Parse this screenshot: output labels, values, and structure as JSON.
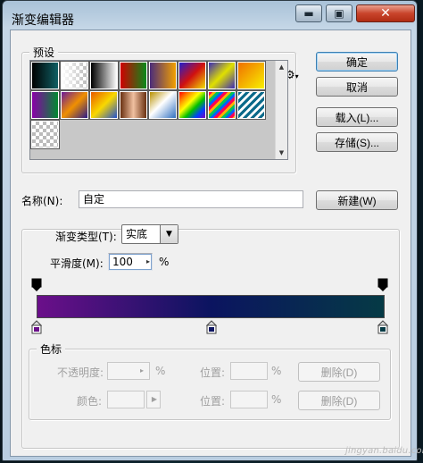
{
  "window": {
    "title": "渐变编辑器",
    "controls": {
      "minimize": "▬",
      "maximize": "▣",
      "close": "✕"
    }
  },
  "presets": {
    "legend": "预设",
    "menu_icon": "gear-icon",
    "swatches": [
      {
        "bg": "linear-gradient(90deg,#000,#0f5f64)"
      },
      {
        "bg": "linear-gradient(90deg,#fff 0%,rgba(255,255,255,0) 100%),repeating-conic-gradient(#bbb 0 25%,#fff 0 50%) 0 0/8px 8px"
      },
      {
        "bg": "linear-gradient(90deg,#000,#fff)"
      },
      {
        "bg": "linear-gradient(90deg,#d00000,#0a8a1a)"
      },
      {
        "bg": "linear-gradient(90deg,#4b2c7a,#f2a000)"
      },
      {
        "bg": "linear-gradient(135deg,#2020d0 0%,#d01010 50%,#f0e000 100%)"
      },
      {
        "bg": "linear-gradient(135deg,#3a2ab8 0%,#e0e000 50%,#3a2ab8 100%)"
      },
      {
        "bg": "linear-gradient(135deg,#f07000,#f8f000)"
      },
      {
        "bg": "linear-gradient(90deg,#8a00a8,#008a30)"
      },
      {
        "bg": "linear-gradient(135deg,#6a1a9a 0%,#f09000 50%,#2a1a8a 100%)"
      },
      {
        "bg": "linear-gradient(135deg,#e85a00 0%,#f8d800 50%,#2050d0 100%)"
      },
      {
        "bg": "linear-gradient(90deg,#6a3010,#f0c0a0,#6a3010)"
      },
      {
        "bg": "linear-gradient(135deg,#b89000 0%,#fff 45%,#3070c0 100%)"
      },
      {
        "bg": "linear-gradient(135deg,#ff0000,#ff8800,#ffff00,#00c000,#0040ff,#8000c0)"
      },
      {
        "bg": "repeating-linear-gradient(135deg,#ff0050 0 3px,#ffb000 3px 6px,#00c060 6px 9px,#0060ff 9px 12px),repeating-conic-gradient(#bbb 0 25%,#fff 0 50%) 0 0/8px 8px"
      },
      {
        "bg": "repeating-linear-gradient(135deg,#0a6a8a 0 3px,#ffffff 3px 6px)"
      },
      {
        "bg": "repeating-conic-gradient(#bbb 0 25%,#fff 0 50%) 0 0/8px 8px"
      }
    ]
  },
  "buttons": {
    "ok": "确定",
    "cancel": "取消",
    "load": "载入(L)...",
    "save": "存储(S)...",
    "new": "新建(W)"
  },
  "name": {
    "label": "名称(N):",
    "value": "自定"
  },
  "gradient": {
    "type_label": "渐变类型(T):",
    "type_value": "实底",
    "smooth_label": "平滑度(M):",
    "smooth_value": "100",
    "smooth_unit": "%",
    "colors": [
      "#6b0f8a",
      "#0b1460",
      "#053a45"
    ]
  },
  "stops": {
    "legend": "色标",
    "opacity_label": "不透明度:",
    "opacity_unit": "%",
    "location_label": "位置:",
    "location_unit": "%",
    "color_label": "颜色:",
    "delete": "删除(D)"
  },
  "watermark": "jingyan.baidu.com"
}
